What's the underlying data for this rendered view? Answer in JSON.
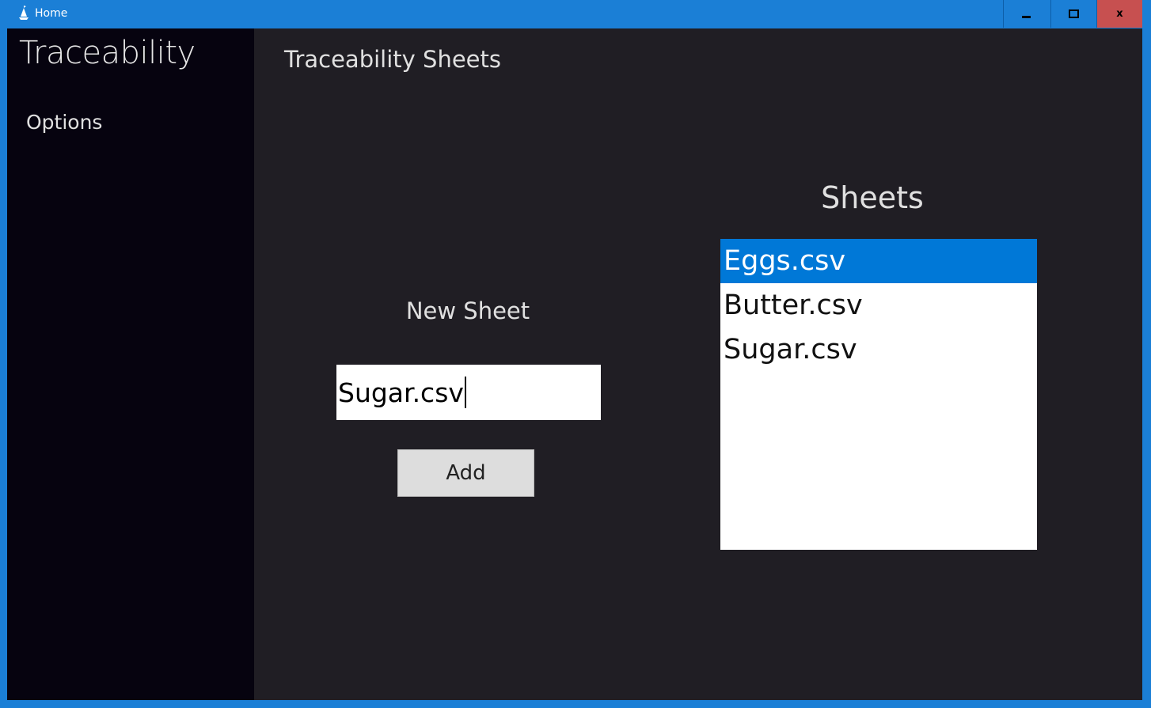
{
  "window": {
    "title": "Home",
    "controls": {
      "minimize": "minimize",
      "maximize": "maximize",
      "close": "x"
    }
  },
  "sidebar": {
    "app_name": "Traceability",
    "items": [
      {
        "label": "Options"
      }
    ]
  },
  "main": {
    "title": "Traceability Sheets",
    "new_sheet": {
      "label": "New Sheet",
      "input_value": "Sugar.csv",
      "add_label": "Add"
    },
    "sheets": {
      "label": "Sheets",
      "items": [
        {
          "label": "Eggs.csv",
          "selected": true
        },
        {
          "label": "Butter.csv",
          "selected": false
        },
        {
          "label": "Sugar.csv",
          "selected": false
        }
      ]
    }
  },
  "colors": {
    "titlebar": "#1b7fd6",
    "sidebar_bg": "#06030f",
    "main_bg": "#201e24",
    "selection": "#0078d7",
    "close_button": "#c75050"
  }
}
